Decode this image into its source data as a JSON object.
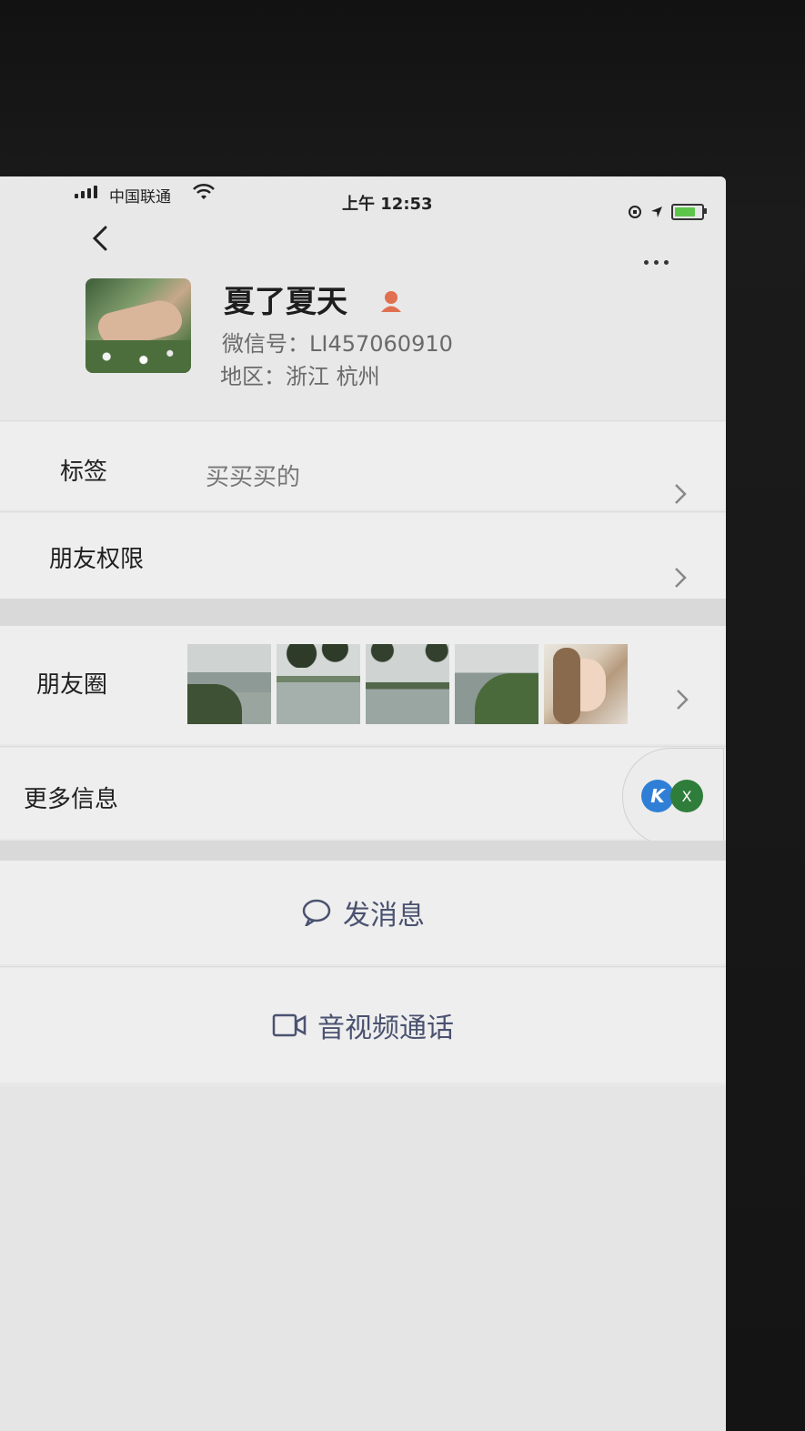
{
  "status_bar": {
    "carrier": "中国联通",
    "time": "上午 12:53"
  },
  "profile": {
    "name": "夏了夏天",
    "wechat_id": "微信号：LI457060910",
    "region": "地区：浙江 杭州"
  },
  "rows": {
    "tags_label": "标签",
    "tags_value": "买买买的",
    "permissions_label": "朋友权限",
    "moments_label": "朋友圈",
    "more_info_label": "更多信息"
  },
  "actions": {
    "message_label": "发消息",
    "call_label": "音视频通话"
  },
  "float_widget": {
    "k_label": "K",
    "x_label": "X"
  },
  "colors": {
    "accent_text": "#4a5270",
    "gender_icon": "#e0704f",
    "battery": "#5dc64a"
  },
  "icons": [
    "signal-icon",
    "wifi-icon",
    "back-arrow-icon",
    "more-dots-icon",
    "gender-icon",
    "chevron-right-icon",
    "chat-bubble-icon",
    "video-camera-icon"
  ]
}
